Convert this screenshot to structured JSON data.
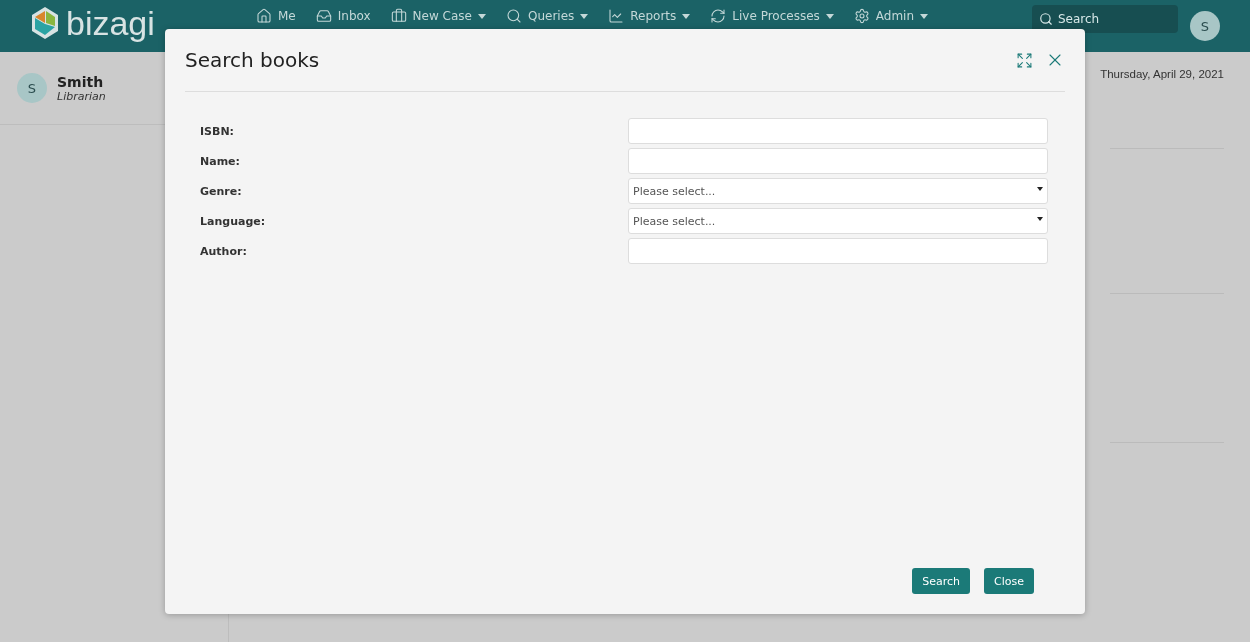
{
  "header": {
    "logo": "bizagi",
    "nav": [
      {
        "label": "Me",
        "dropdown": false
      },
      {
        "label": "Inbox",
        "dropdown": false
      },
      {
        "label": "New Case",
        "dropdown": true
      },
      {
        "label": "Queries",
        "dropdown": true
      },
      {
        "label": "Reports",
        "dropdown": true
      },
      {
        "label": "Live Processes",
        "dropdown": true
      },
      {
        "label": "Admin",
        "dropdown": true
      }
    ],
    "search": {
      "placeholder": "Search"
    },
    "avatar": "S"
  },
  "user": {
    "initial": "S",
    "name": "Smith",
    "role": "Librarian"
  },
  "date": "Thursday, April 29, 2021",
  "dialog": {
    "title": "Search books",
    "fields": [
      {
        "label": "ISBN:",
        "kind": "text"
      },
      {
        "label": "Name:",
        "kind": "text"
      },
      {
        "label": "Genre:",
        "kind": "select",
        "placeholder": "Please select..."
      },
      {
        "label": "Language:",
        "kind": "select",
        "placeholder": "Please select..."
      },
      {
        "label": "Author:",
        "kind": "text"
      }
    ],
    "buttons": [
      "Search",
      "Close"
    ]
  }
}
